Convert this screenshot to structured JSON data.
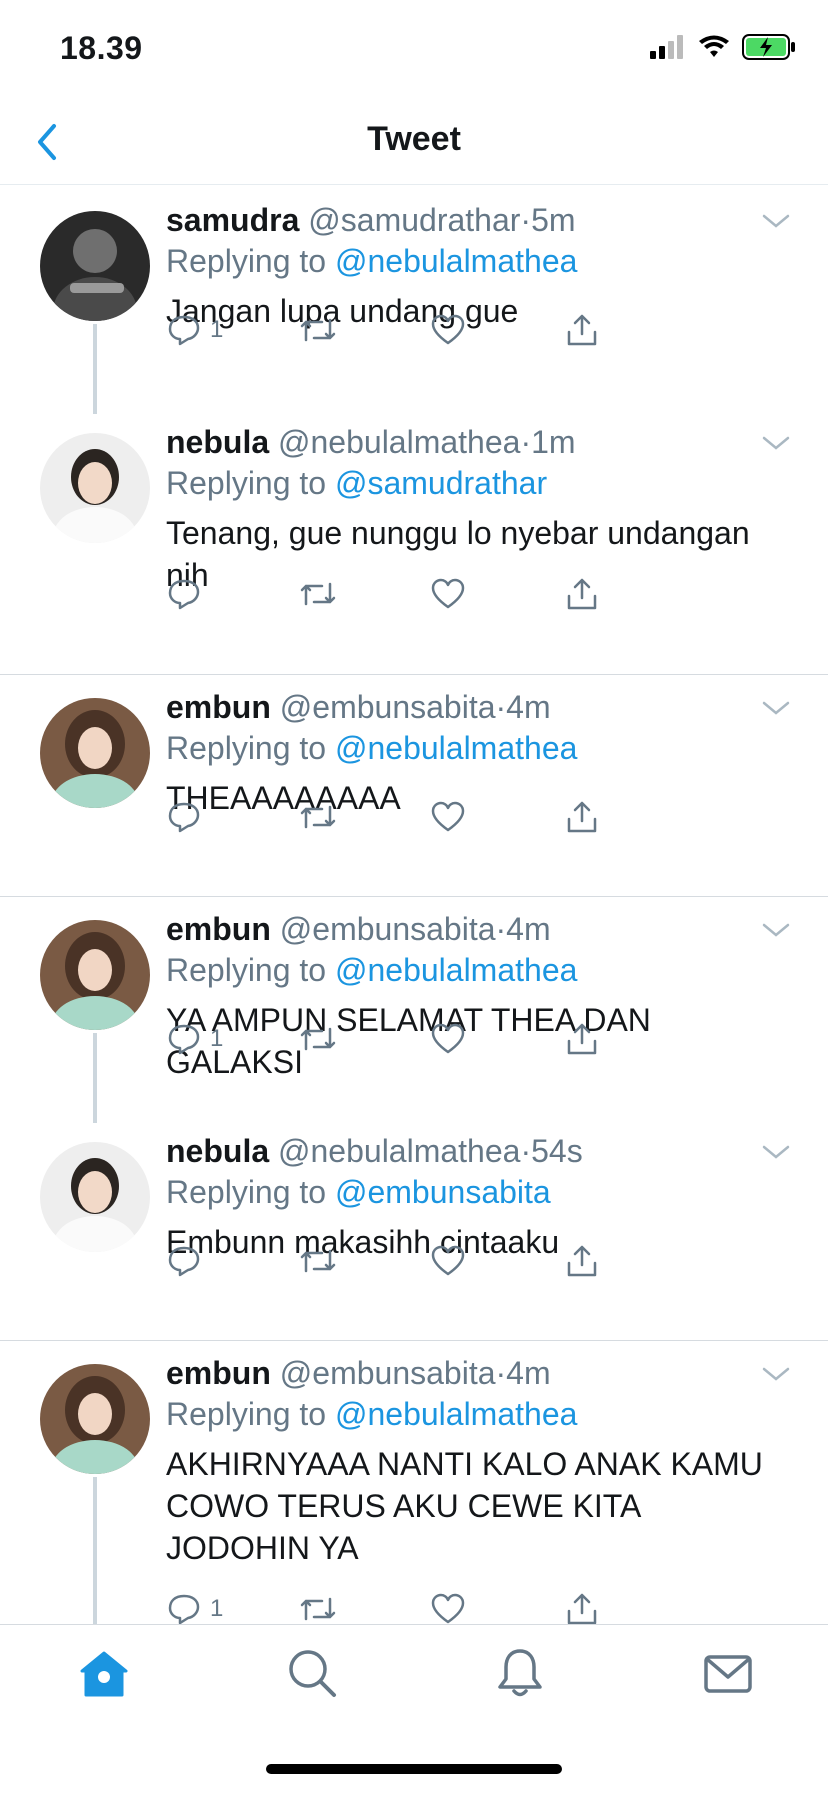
{
  "status_bar": {
    "time": "18.39"
  },
  "nav": {
    "title": "Tweet"
  },
  "tweets": [
    {
      "name": "samudra",
      "handle": "@samudrathar",
      "time": "5m",
      "replying_label": "Replying to",
      "replying_to": "@nebulalmathea",
      "text": "Jangan lupa undang gue",
      "reply_count": "1"
    },
    {
      "name": "nebula",
      "handle": "@nebulalmathea",
      "time": "1m",
      "replying_label": "Replying to",
      "replying_to": "@samudrathar",
      "text": "Tenang, gue nunggu lo nyebar undangan nih",
      "reply_count": ""
    },
    {
      "name": "embun",
      "handle": "@embunsabita",
      "time": "4m",
      "replying_label": "Replying to",
      "replying_to": "@nebulalmathea",
      "text": "THEAAAAAAAA",
      "reply_count": ""
    },
    {
      "name": "embun",
      "handle": "@embunsabita",
      "time": "4m",
      "replying_label": "Replying to",
      "replying_to": "@nebulalmathea",
      "text": "YA AMPUN SELAMAT THEA DAN GALAKSI",
      "reply_count": "1"
    },
    {
      "name": "nebula",
      "handle": "@nebulalmathea",
      "time": "54s",
      "replying_label": "Replying to",
      "replying_to": "@embunsabita",
      "text": "Embunn makasihh cintaaku",
      "reply_count": ""
    },
    {
      "name": "embun",
      "handle": "@embunsabita",
      "time": "4m",
      "replying_label": "Replying to",
      "replying_to": "@nebulalmathea",
      "text": "AKHIRNYAAA NANTI KALO ANAK KAMU COWO TERUS AKU CEWE KITA JODOHIN YA",
      "reply_count": "1"
    }
  ],
  "tab_bar": {
    "tabs": [
      "home-icon",
      "search-icon",
      "bell-icon",
      "mail-icon"
    ]
  },
  "colors": {
    "accent": "#1b95e0",
    "muted": "#657786",
    "divider": "#d6dbe0"
  }
}
